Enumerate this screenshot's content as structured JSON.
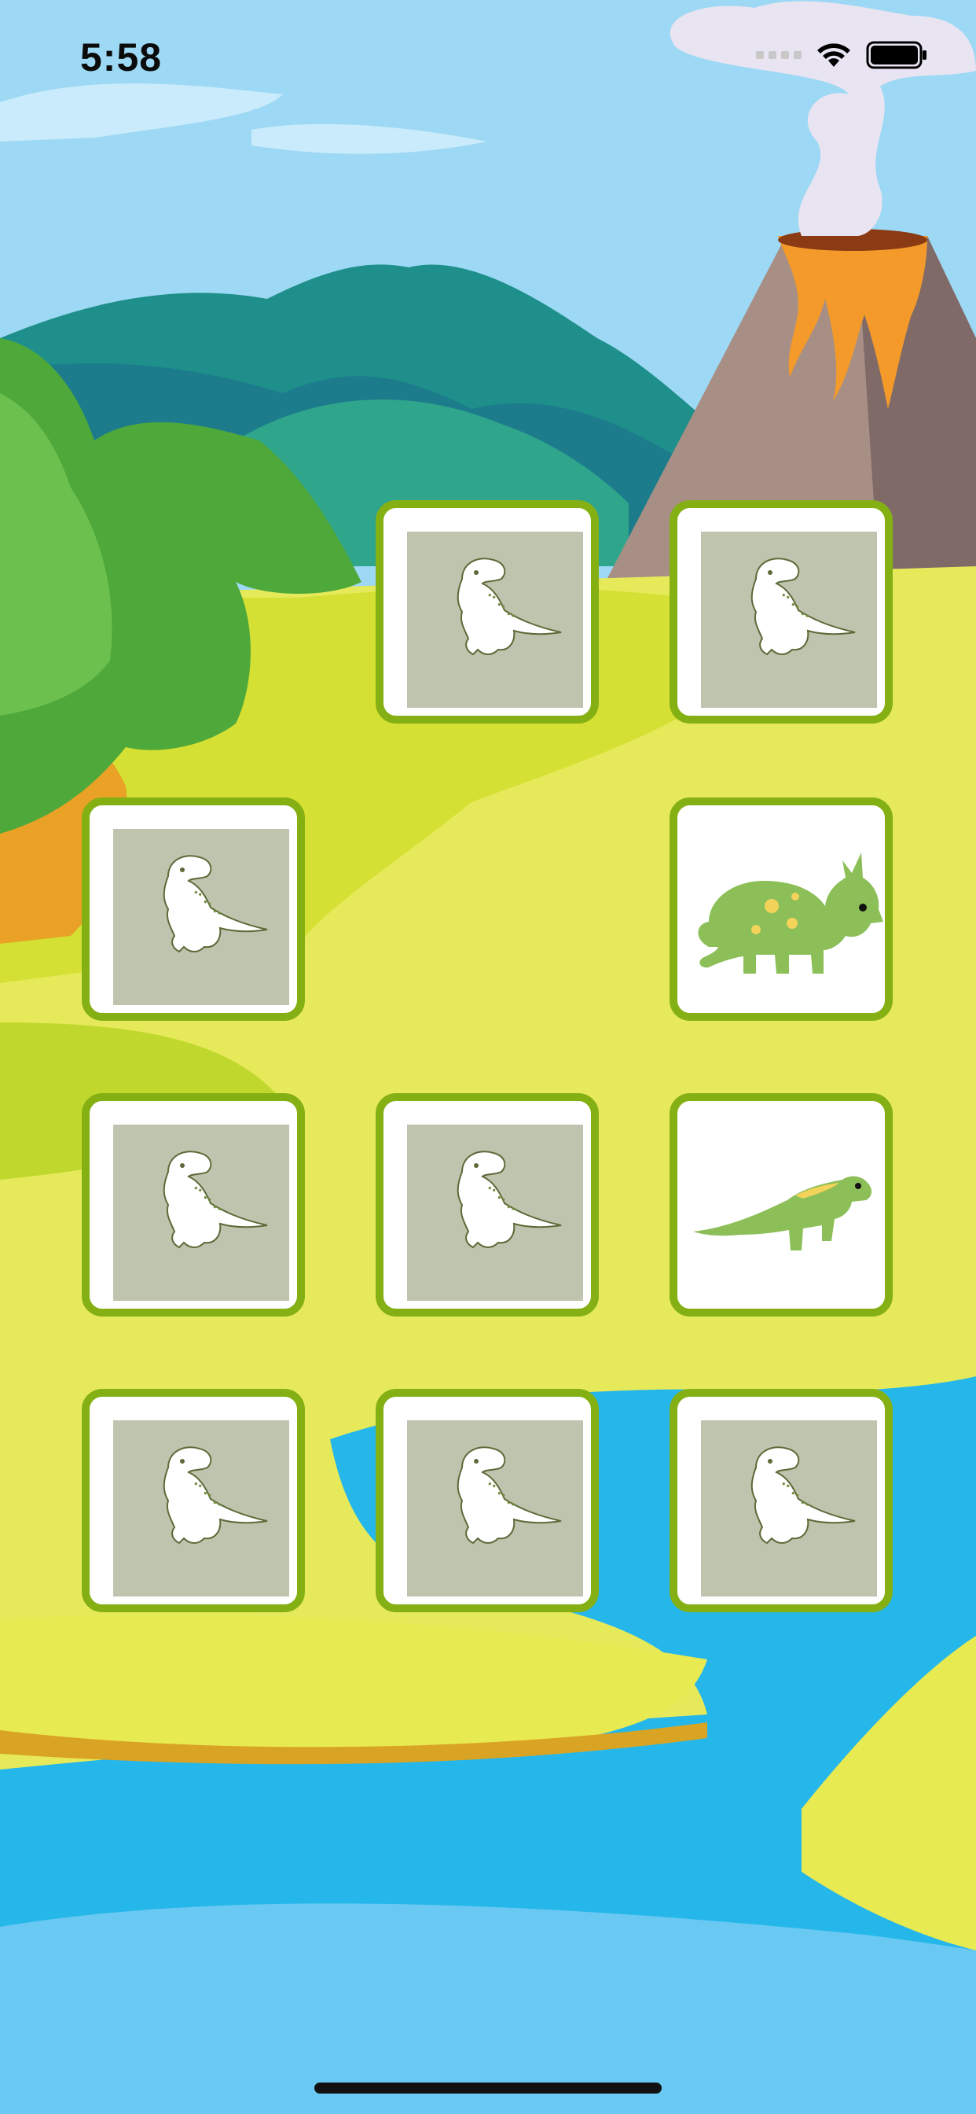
{
  "status_bar": {
    "time": "5:58",
    "signal_icon": "signal-dots-icon",
    "wifi_icon": "wifi-icon",
    "battery_icon": "battery-icon"
  },
  "colors": {
    "sky": "#9dd9f4",
    "grass": "#e6ea5a",
    "river": "#26b7ea",
    "card_border": "#84b014",
    "card_back": "#bfc4ae",
    "dino_green": "#8dbf58",
    "dino_spot": "#f3d35a"
  },
  "board": {
    "rows": 4,
    "cols": 3,
    "cards": [
      {
        "row": 0,
        "col": 0,
        "state": "matched"
      },
      {
        "row": 0,
        "col": 1,
        "state": "face-down",
        "icon": "dinosaur-sketch-icon"
      },
      {
        "row": 0,
        "col": 2,
        "state": "face-down",
        "icon": "dinosaur-sketch-icon"
      },
      {
        "row": 1,
        "col": 0,
        "state": "face-down",
        "icon": "dinosaur-sketch-icon"
      },
      {
        "row": 1,
        "col": 1,
        "state": "matched"
      },
      {
        "row": 1,
        "col": 2,
        "state": "face-up",
        "icon": "triceratops-icon"
      },
      {
        "row": 2,
        "col": 0,
        "state": "face-down",
        "icon": "dinosaur-sketch-icon"
      },
      {
        "row": 2,
        "col": 1,
        "state": "face-down",
        "icon": "dinosaur-sketch-icon"
      },
      {
        "row": 2,
        "col": 2,
        "state": "face-up",
        "icon": "iguanodon-icon"
      },
      {
        "row": 3,
        "col": 0,
        "state": "face-down",
        "icon": "dinosaur-sketch-icon"
      },
      {
        "row": 3,
        "col": 1,
        "state": "face-down",
        "icon": "dinosaur-sketch-icon"
      },
      {
        "row": 3,
        "col": 2,
        "state": "face-down",
        "icon": "dinosaur-sketch-icon"
      }
    ]
  }
}
